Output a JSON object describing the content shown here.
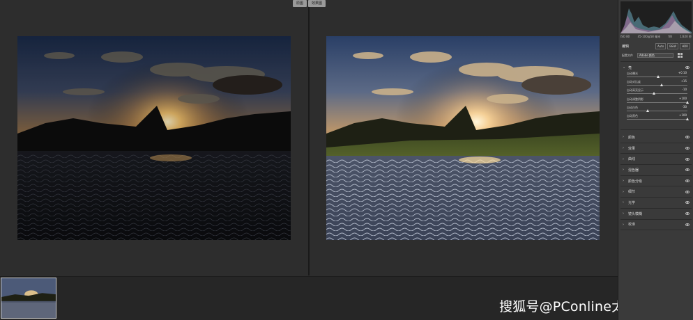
{
  "compare": {
    "before_label": "原图",
    "after_label": "效果图"
  },
  "watermark": {
    "text": "搜狐号@PConline太平洋科技"
  },
  "panel": {
    "camera_info": [
      "ISO 80",
      "45-100@58 毫米",
      "f/8",
      "1/320 秒"
    ],
    "edit_title": "编辑",
    "buttons": [
      "Auto",
      "B&W",
      "HDR"
    ],
    "profile_label": "配置文件",
    "profile_value": "Adobe 颜色",
    "light_section": {
      "title": "亮",
      "sliders": [
        {
          "label": "自动曝光",
          "value": "+0.10",
          "position": 0.52
        },
        {
          "label": "自动对比度",
          "value": "+15",
          "position": 0.58
        },
        {
          "label": "自动高亮显示",
          "value": "-10",
          "position": 0.45
        },
        {
          "label": "自动调整阴影",
          "value": "+100",
          "position": 1.0
        },
        {
          "label": "自动白色",
          "value": "-30",
          "position": 0.35
        },
        {
          "label": "自动黑色",
          "value": "+100",
          "position": 1.0
        }
      ]
    },
    "sections": [
      "颜色",
      "效果",
      "曲线",
      "混色器",
      "颜色分级",
      "细节",
      "光学",
      "镜头模糊",
      "校准"
    ]
  },
  "colors": {
    "panel_bg": "#3a3a3a",
    "workspace_bg": "#2d2d2d",
    "accent": "#e6e6e6"
  },
  "icons": {
    "eye": "eye-icon",
    "chevron": "chevron-right-icon",
    "expanded": "chevron-down-icon",
    "profile_grid": "grid-icon"
  }
}
